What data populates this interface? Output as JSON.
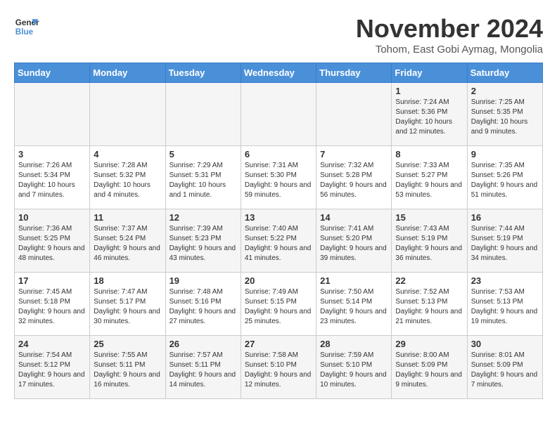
{
  "header": {
    "logo_line1": "General",
    "logo_line2": "Blue",
    "month_title": "November 2024",
    "subtitle": "Tohom, East Gobi Aymag, Mongolia"
  },
  "weekdays": [
    "Sunday",
    "Monday",
    "Tuesday",
    "Wednesday",
    "Thursday",
    "Friday",
    "Saturday"
  ],
  "weeks": [
    [
      {
        "day": "",
        "info": ""
      },
      {
        "day": "",
        "info": ""
      },
      {
        "day": "",
        "info": ""
      },
      {
        "day": "",
        "info": ""
      },
      {
        "day": "",
        "info": ""
      },
      {
        "day": "1",
        "info": "Sunrise: 7:24 AM\nSunset: 5:36 PM\nDaylight: 10 hours and 12 minutes."
      },
      {
        "day": "2",
        "info": "Sunrise: 7:25 AM\nSunset: 5:35 PM\nDaylight: 10 hours and 9 minutes."
      }
    ],
    [
      {
        "day": "3",
        "info": "Sunrise: 7:26 AM\nSunset: 5:34 PM\nDaylight: 10 hours and 7 minutes."
      },
      {
        "day": "4",
        "info": "Sunrise: 7:28 AM\nSunset: 5:32 PM\nDaylight: 10 hours and 4 minutes."
      },
      {
        "day": "5",
        "info": "Sunrise: 7:29 AM\nSunset: 5:31 PM\nDaylight: 10 hours and 1 minute."
      },
      {
        "day": "6",
        "info": "Sunrise: 7:31 AM\nSunset: 5:30 PM\nDaylight: 9 hours and 59 minutes."
      },
      {
        "day": "7",
        "info": "Sunrise: 7:32 AM\nSunset: 5:28 PM\nDaylight: 9 hours and 56 minutes."
      },
      {
        "day": "8",
        "info": "Sunrise: 7:33 AM\nSunset: 5:27 PM\nDaylight: 9 hours and 53 minutes."
      },
      {
        "day": "9",
        "info": "Sunrise: 7:35 AM\nSunset: 5:26 PM\nDaylight: 9 hours and 51 minutes."
      }
    ],
    [
      {
        "day": "10",
        "info": "Sunrise: 7:36 AM\nSunset: 5:25 PM\nDaylight: 9 hours and 48 minutes."
      },
      {
        "day": "11",
        "info": "Sunrise: 7:37 AM\nSunset: 5:24 PM\nDaylight: 9 hours and 46 minutes."
      },
      {
        "day": "12",
        "info": "Sunrise: 7:39 AM\nSunset: 5:23 PM\nDaylight: 9 hours and 43 minutes."
      },
      {
        "day": "13",
        "info": "Sunrise: 7:40 AM\nSunset: 5:22 PM\nDaylight: 9 hours and 41 minutes."
      },
      {
        "day": "14",
        "info": "Sunrise: 7:41 AM\nSunset: 5:20 PM\nDaylight: 9 hours and 39 minutes."
      },
      {
        "day": "15",
        "info": "Sunrise: 7:43 AM\nSunset: 5:19 PM\nDaylight: 9 hours and 36 minutes."
      },
      {
        "day": "16",
        "info": "Sunrise: 7:44 AM\nSunset: 5:19 PM\nDaylight: 9 hours and 34 minutes."
      }
    ],
    [
      {
        "day": "17",
        "info": "Sunrise: 7:45 AM\nSunset: 5:18 PM\nDaylight: 9 hours and 32 minutes."
      },
      {
        "day": "18",
        "info": "Sunrise: 7:47 AM\nSunset: 5:17 PM\nDaylight: 9 hours and 30 minutes."
      },
      {
        "day": "19",
        "info": "Sunrise: 7:48 AM\nSunset: 5:16 PM\nDaylight: 9 hours and 27 minutes."
      },
      {
        "day": "20",
        "info": "Sunrise: 7:49 AM\nSunset: 5:15 PM\nDaylight: 9 hours and 25 minutes."
      },
      {
        "day": "21",
        "info": "Sunrise: 7:50 AM\nSunset: 5:14 PM\nDaylight: 9 hours and 23 minutes."
      },
      {
        "day": "22",
        "info": "Sunrise: 7:52 AM\nSunset: 5:13 PM\nDaylight: 9 hours and 21 minutes."
      },
      {
        "day": "23",
        "info": "Sunrise: 7:53 AM\nSunset: 5:13 PM\nDaylight: 9 hours and 19 minutes."
      }
    ],
    [
      {
        "day": "24",
        "info": "Sunrise: 7:54 AM\nSunset: 5:12 PM\nDaylight: 9 hours and 17 minutes."
      },
      {
        "day": "25",
        "info": "Sunrise: 7:55 AM\nSunset: 5:11 PM\nDaylight: 9 hours and 16 minutes."
      },
      {
        "day": "26",
        "info": "Sunrise: 7:57 AM\nSunset: 5:11 PM\nDaylight: 9 hours and 14 minutes."
      },
      {
        "day": "27",
        "info": "Sunrise: 7:58 AM\nSunset: 5:10 PM\nDaylight: 9 hours and 12 minutes."
      },
      {
        "day": "28",
        "info": "Sunrise: 7:59 AM\nSunset: 5:10 PM\nDaylight: 9 hours and 10 minutes."
      },
      {
        "day": "29",
        "info": "Sunrise: 8:00 AM\nSunset: 5:09 PM\nDaylight: 9 hours and 9 minutes."
      },
      {
        "day": "30",
        "info": "Sunrise: 8:01 AM\nSunset: 5:09 PM\nDaylight: 9 hours and 7 minutes."
      }
    ]
  ]
}
